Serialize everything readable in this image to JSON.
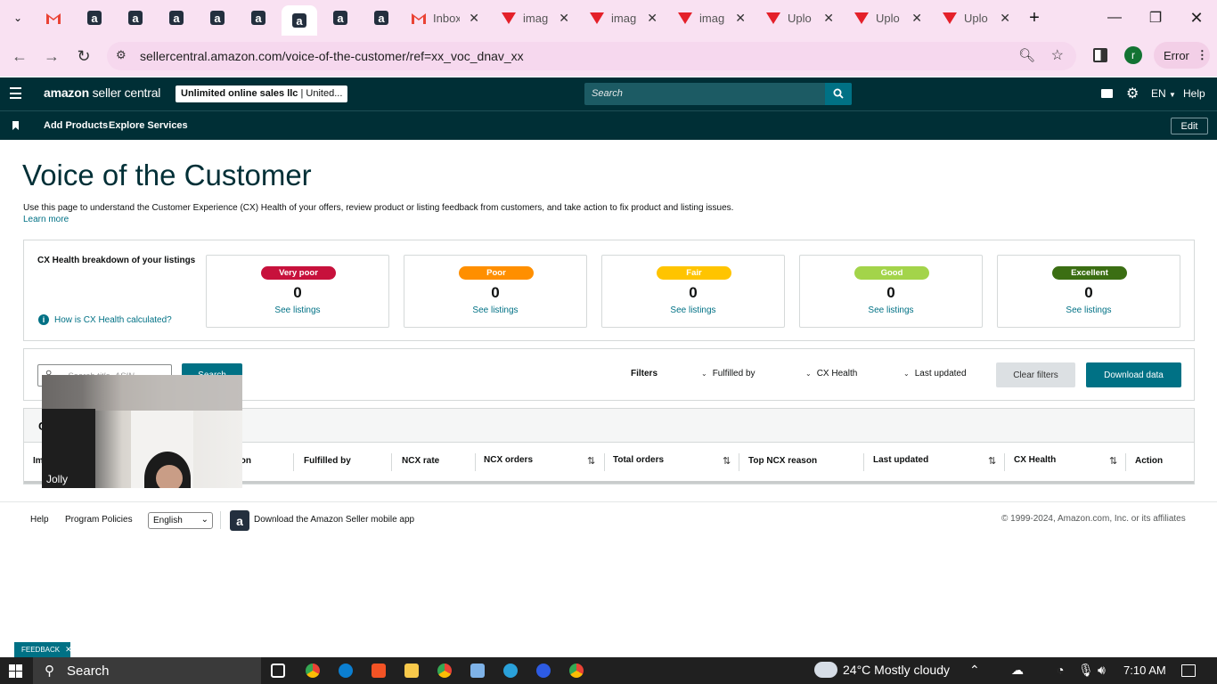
{
  "browser": {
    "tabs": [
      {
        "kind": "gmail",
        "title": ""
      },
      {
        "kind": "amazon",
        "title": ""
      },
      {
        "kind": "amazon",
        "title": ""
      },
      {
        "kind": "amazon",
        "title": ""
      },
      {
        "kind": "amazon",
        "title": ""
      },
      {
        "kind": "amazon",
        "title": ""
      },
      {
        "kind": "amazon",
        "title": "",
        "active": true
      },
      {
        "kind": "amazon",
        "title": ""
      },
      {
        "kind": "amazon",
        "title": ""
      },
      {
        "kind": "gmail",
        "title": "Inbox"
      },
      {
        "kind": "v",
        "title": "imag"
      },
      {
        "kind": "v",
        "title": "imag"
      },
      {
        "kind": "v",
        "title": "imag"
      },
      {
        "kind": "v",
        "title": "Uplo"
      },
      {
        "kind": "v",
        "title": "Uplo"
      },
      {
        "kind": "v",
        "title": "Uplo"
      }
    ],
    "url": "sellercentral.amazon.com/voice-of-the-customer/ref=xx_voc_dnav_xx",
    "profile_initial": "r",
    "error_label": "Error"
  },
  "header": {
    "logo_bold": "amazon",
    "logo_rest": " seller central",
    "account_bold": "Unlimited online sales llc",
    "account_rest": " | United...",
    "search_placeholder": "Search",
    "lang": "EN",
    "help": "Help"
  },
  "subnav": {
    "items": [
      "Add Products",
      "Explore Services"
    ],
    "edit": "Edit"
  },
  "page": {
    "title": "Voice of the Customer",
    "description": "Use this page to understand the Customer Experience (CX) Health of your offers, review product or listing feedback from customers, and take action to fix product and listing issues.",
    "learn_more": "Learn more"
  },
  "cx": {
    "heading": "CX Health breakdown of your listings",
    "how_link": "How is CX Health calculated?",
    "cards": [
      {
        "label": "Very poor",
        "count": "0",
        "link": "See listings",
        "color": "#c7113c",
        "text_color": "#ffffff"
      },
      {
        "label": "Poor",
        "count": "0",
        "link": "See listings",
        "color": "#ff8f00",
        "text_color": "#ffffff"
      },
      {
        "label": "Fair",
        "count": "0",
        "link": "See listings",
        "color": "#ffc400",
        "text_color": "#ffffff"
      },
      {
        "label": "Good",
        "count": "0",
        "link": "See listings",
        "color": "#a3d44a",
        "text_color": "#ffffff"
      },
      {
        "label": "Excellent",
        "count": "0",
        "link": "See listings",
        "color": "#3b6e13",
        "text_color": "#ffffff"
      }
    ]
  },
  "filters": {
    "search_placeholder": "Search title, ASIN",
    "search_button": "Search",
    "label": "Filters",
    "fulfilled_by": "Fulfilled by",
    "cx_health": "CX Health",
    "last_updated": "Last updated",
    "clear": "Clear filters",
    "download": "Download data"
  },
  "table": {
    "partial_left": "Im",
    "partial_left2": "ion",
    "partial_title": "C",
    "columns": [
      "Fulfilled by",
      "NCX rate",
      "NCX orders",
      "Total orders",
      "Top NCX reason",
      "Last updated",
      "CX Health",
      "Action"
    ]
  },
  "video": {
    "name": "Jolly"
  },
  "footer": {
    "help": "Help",
    "policies": "Program Policies",
    "language": "English",
    "app": "Download the Amazon Seller mobile app",
    "copyright": "© 1999-2024, Amazon.com, Inc. or its affiliates"
  },
  "feedback": "FEEDBACK",
  "taskbar": {
    "search": "Search",
    "weather": "24°C  Mostly cloudy",
    "time": "7:10 AM"
  }
}
